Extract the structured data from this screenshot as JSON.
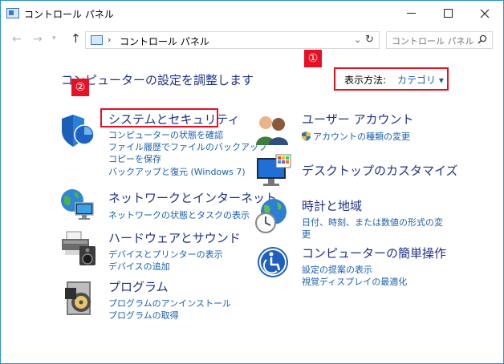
{
  "window": {
    "title": "コントロール パネル",
    "minimize_icon": "minimize-icon",
    "maximize_icon": "maximize-icon",
    "close_icon": "close-icon"
  },
  "address_bar": {
    "path": "コントロール パネル",
    "search_placeholder": "コントロール パネル"
  },
  "main": {
    "heading": "コンピューターの設定を調整します",
    "view_by_label": "表示方法:",
    "view_by_value": "カテゴリ ▾",
    "markers": [
      "①",
      "②"
    ],
    "marker_color": "#e81123"
  },
  "categories_left": [
    {
      "title": "システムとセキュリティ",
      "icon": "shield-icon",
      "links": [
        "コンピューターの状態を確認",
        "ファイル履歴でファイルのバックアップ",
        "コピーを保存",
        "バックアップと復元 (Windows 7)"
      ]
    },
    {
      "title": "ネットワークとインターネット",
      "icon": "network-globe-icon",
      "links": [
        "ネットワークの状態とタスクの表示"
      ]
    },
    {
      "title": "ハードウェアとサウンド",
      "icon": "printer-speaker-icon",
      "links": [
        "デバイスとプリンターの表示",
        "デバイスの追加"
      ]
    },
    {
      "title": "プログラム",
      "icon": "programs-disc-icon",
      "links": [
        "プログラムのアンインストール",
        "プログラムの取得"
      ]
    }
  ],
  "categories_right": [
    {
      "title": "ユーザー アカウント",
      "icon": "user-accounts-icon",
      "links": [
        "アカウントの種類の変更"
      ]
    },
    {
      "title": "デスクトップのカスタマイズ",
      "icon": "desktop-monitor-icon",
      "links": []
    },
    {
      "title": "時計と地域",
      "icon": "clock-globe-icon",
      "links": [
        "日付、時刻、または数値の形式の変",
        "更"
      ]
    },
    {
      "title": "コンピューターの簡単操作",
      "icon": "ease-of-access-icon",
      "links": [
        "設定の提案の表示",
        "視覚ディスプレイの最適化"
      ]
    }
  ],
  "colors": {
    "link": "#1a5fb4",
    "category_title": "#1e3287",
    "highlight": "#e81123"
  }
}
